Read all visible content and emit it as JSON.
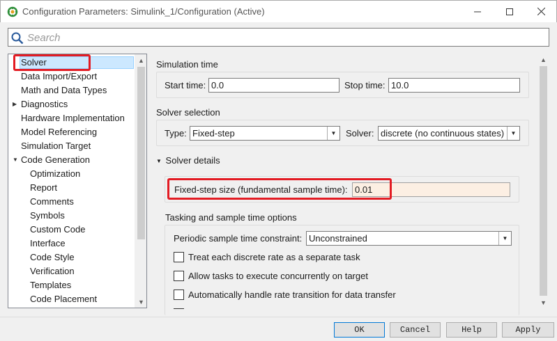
{
  "window": {
    "title": "Configuration Parameters: Simulink_1/Configuration (Active)"
  },
  "search": {
    "placeholder": "Search"
  },
  "tree": {
    "items": [
      {
        "label": "Solver",
        "selected": true
      },
      {
        "label": "Data Import/Export"
      },
      {
        "label": "Math and Data Types"
      },
      {
        "label": "Diagnostics",
        "arrow": "right"
      },
      {
        "label": "Hardware Implementation"
      },
      {
        "label": "Model Referencing"
      },
      {
        "label": "Simulation Target"
      },
      {
        "label": "Code Generation",
        "arrow": "down"
      },
      {
        "label": "Optimization"
      },
      {
        "label": "Report"
      },
      {
        "label": "Comments"
      },
      {
        "label": "Symbols"
      },
      {
        "label": "Custom Code"
      },
      {
        "label": "Interface"
      },
      {
        "label": "Code Style"
      },
      {
        "label": "Verification"
      },
      {
        "label": "Templates"
      },
      {
        "label": "Code Placement"
      }
    ]
  },
  "simulation_time": {
    "title": "Simulation time",
    "start_label": "Start time:",
    "start_value": "0.0",
    "stop_label": "Stop time:",
    "stop_value": "10.0"
  },
  "solver_selection": {
    "title": "Solver selection",
    "type_label": "Type:",
    "type_value": "Fixed-step",
    "solver_label": "Solver:",
    "solver_value": "discrete (no continuous states)"
  },
  "solver_details": {
    "title": "Solver details",
    "fixed_step_label": "Fixed-step size (fundamental sample time):",
    "fixed_step_value": "0.01"
  },
  "tasking": {
    "title": "Tasking and sample time options",
    "periodic_label": "Periodic sample time constraint:",
    "periodic_value": "Unconstrained",
    "checkboxes": [
      {
        "label": "Treat each discrete rate as a separate task",
        "checked": false
      },
      {
        "label": "Allow tasks to execute concurrently on target",
        "checked": false
      },
      {
        "label": "Automatically handle rate transition for data transfer",
        "checked": false
      }
    ]
  },
  "buttons": {
    "ok": "OK",
    "cancel": "Cancel",
    "help": "Help",
    "apply": "Apply"
  },
  "colors": {
    "highlight": "#e31b23",
    "selection": "#cce8ff",
    "fixed_step_bg": "#fcefe3"
  }
}
